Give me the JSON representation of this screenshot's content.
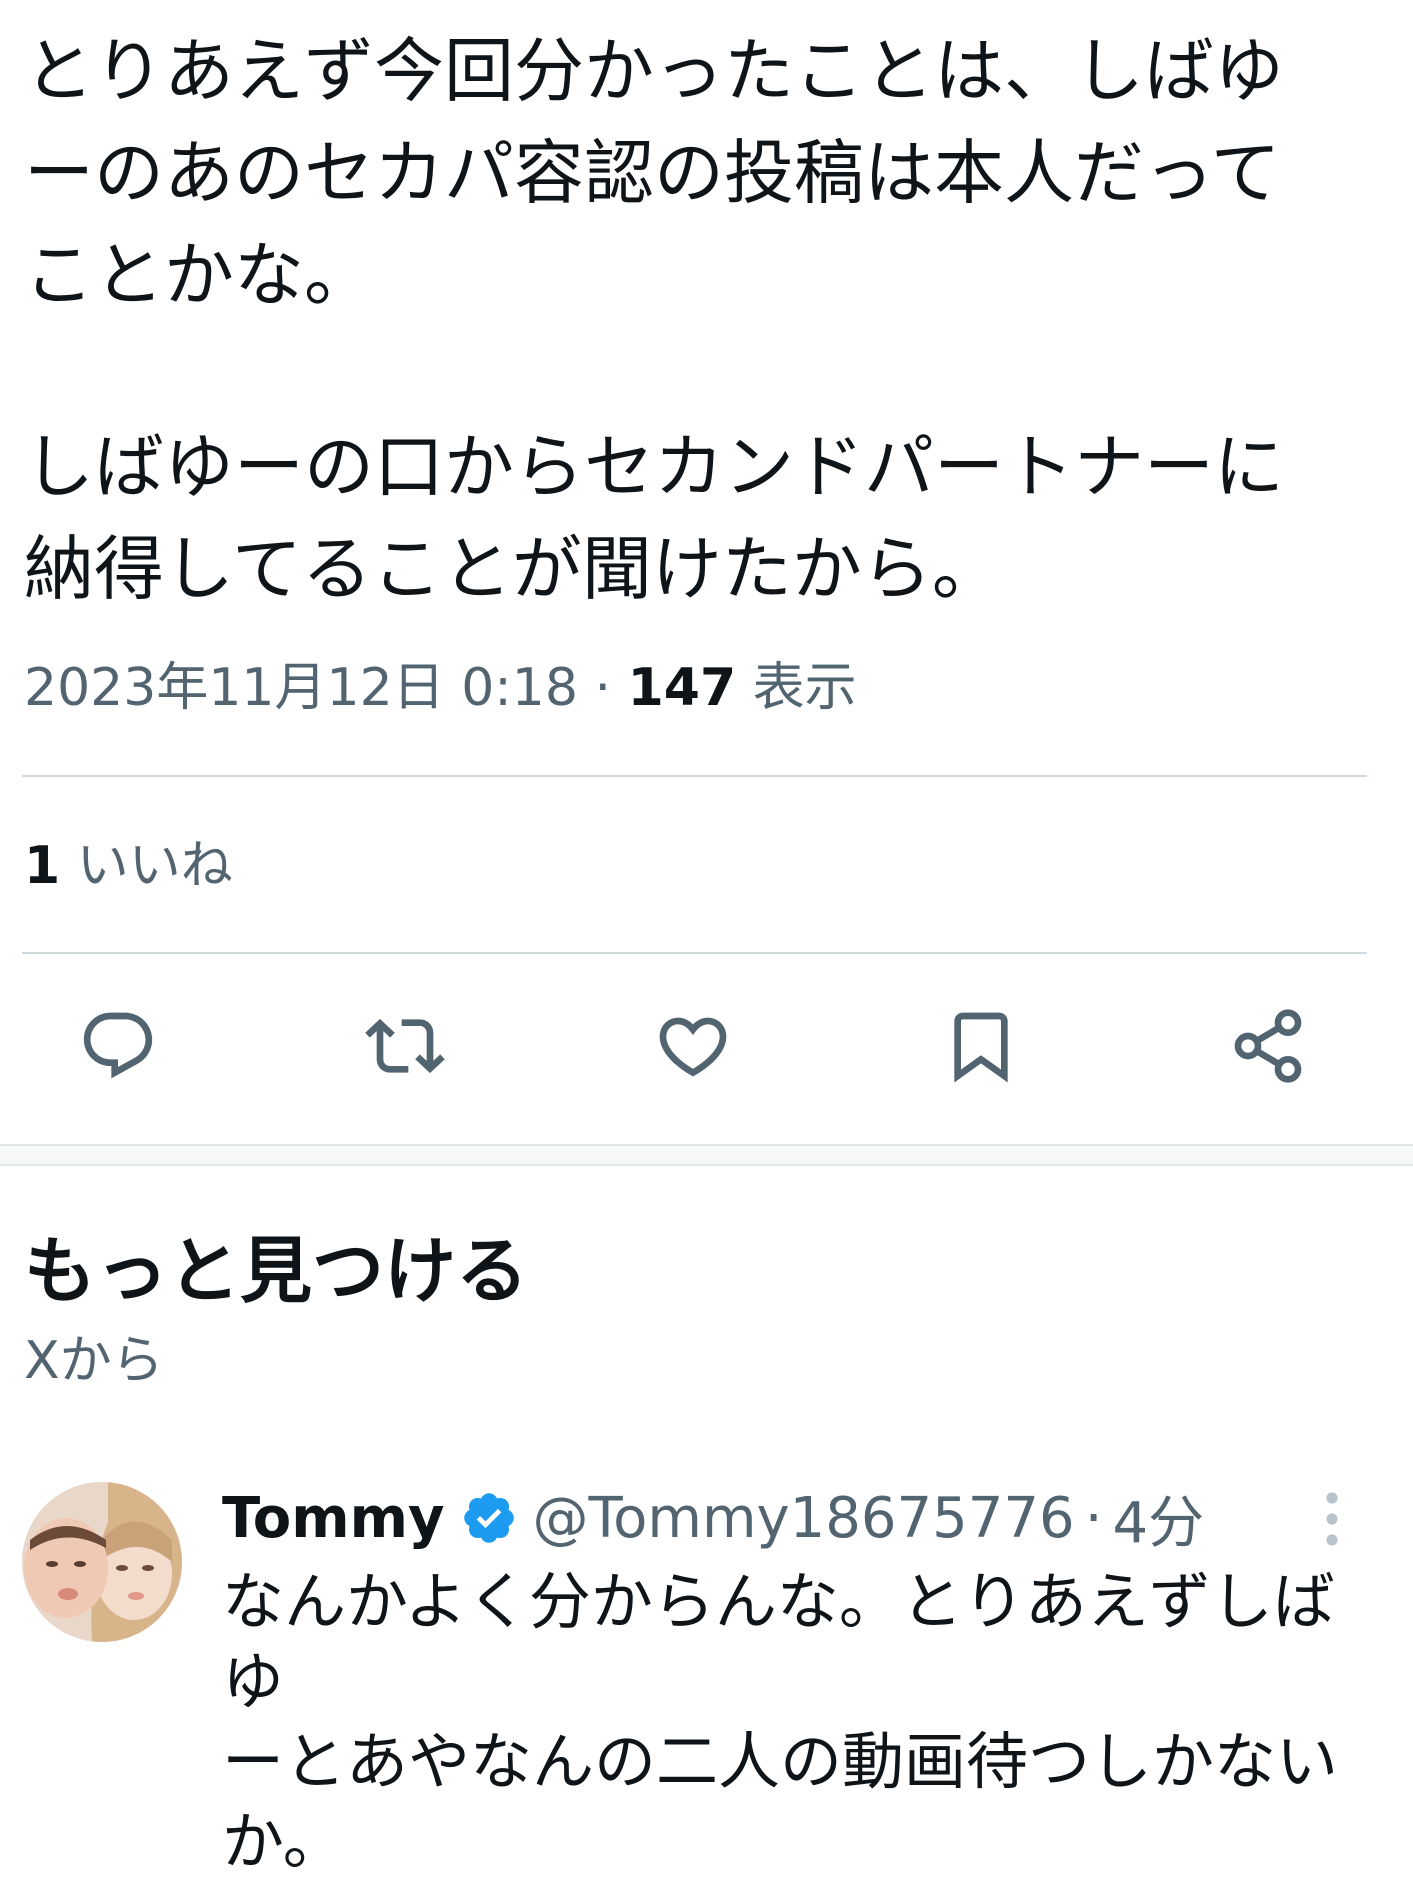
{
  "tweet": {
    "lines_block1": [
      "とりあえず今回分かったことは、しばゆ",
      "ーのあのセカパ容認の投稿は本人だって",
      "ことかな。"
    ],
    "lines_block2": [
      "しばゆーの口からセカンドパートナーに",
      "納得してることが聞けたから。"
    ],
    "timestamp": "2023年11月12日 0:18",
    "separator": "·",
    "views_count": "147",
    "views_label": "表示",
    "likes_count": "1",
    "likes_label": "いいね"
  },
  "actions": {
    "icons": [
      "reply-icon",
      "retweet-icon",
      "like-icon",
      "bookmark-icon",
      "share-icon"
    ]
  },
  "discover": {
    "title": "もっと見つける",
    "subtitle": "Xから"
  },
  "reply": {
    "name": "Tommy",
    "handle": "@Tommy18675776",
    "separator": "·",
    "time": "4分",
    "lines": [
      "なんかよく分からんな。とりあえずしばゆ",
      "ーとあやなんの二人の動画待つしかない",
      "か。"
    ]
  },
  "colors": {
    "text": "#0f1419",
    "secondary": "#536471",
    "divider": "#cfd9de",
    "verified": "#1d9bf0"
  }
}
